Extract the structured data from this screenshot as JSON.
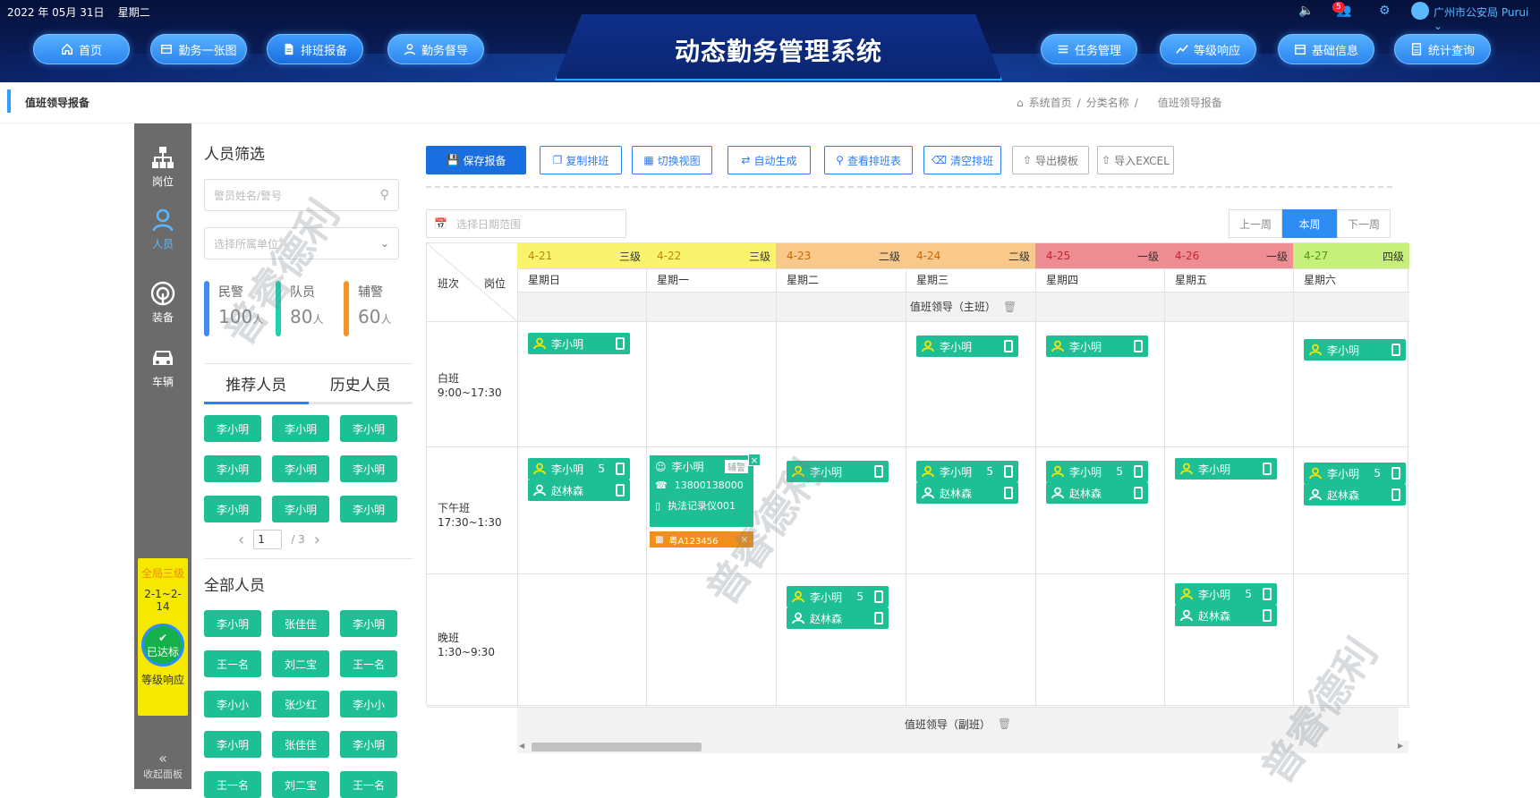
{
  "header": {
    "date": "2022 年 05月 31日",
    "weekday": "星期二",
    "title": "动态勤务管理系统",
    "left_nav": [
      {
        "label": "首页"
      },
      {
        "label": "勤务一张图"
      },
      {
        "label": "排班报备"
      },
      {
        "label": "勤务督导"
      }
    ],
    "right_nav": [
      {
        "label": "任务管理"
      },
      {
        "label": "等级响应"
      },
      {
        "label": "基础信息"
      },
      {
        "label": "统计查询"
      }
    ],
    "notify_count": "5",
    "org": "广州市公安局",
    "user": "Purui"
  },
  "breadcrumb": {
    "page": "值班领导报备",
    "items": [
      "系统首页",
      "/",
      "分类名称",
      "/",
      "值班领导报备"
    ]
  },
  "sidebar": {
    "items": [
      {
        "label": "岗位",
        "icon": "org-chart-icon"
      },
      {
        "label": "人员",
        "icon": "person-icon"
      },
      {
        "label": "装备",
        "icon": "radio-icon"
      },
      {
        "label": "车辆",
        "icon": "car-icon"
      }
    ],
    "level": "全局三级",
    "level_range": "2-1~2-14",
    "reached": "已达标",
    "response": "等级响应",
    "collapse": "收起面板"
  },
  "people": {
    "title": "人员筛选",
    "search_placeholder": "警员姓名/警号",
    "unit_placeholder": "选择所属单位",
    "stats": [
      {
        "label": "民警",
        "value": "100",
        "unit": "人",
        "color": "#3f8cf5"
      },
      {
        "label": "队员",
        "value": "80",
        "unit": "人",
        "color": "#1ed2b2"
      },
      {
        "label": "辅警",
        "value": "60",
        "unit": "人",
        "color": "#f5942a"
      }
    ],
    "tabs": [
      "推荐人员",
      "历史人员"
    ],
    "recommended": [
      "李小明",
      "李小明",
      "李小明",
      "李小明",
      "李小明",
      "李小明",
      "李小明",
      "李小明",
      "李小明"
    ],
    "page": "1",
    "page_total": "/ 3",
    "all_title": "全部人员",
    "all": [
      "李小明",
      "张佳佳",
      "李小明",
      "王一名",
      "刘二宝",
      "王一名",
      "李小小",
      "张少红",
      "李小小",
      "李小明",
      "张佳佳",
      "李小明",
      "王一名",
      "刘二宝",
      "王一名"
    ]
  },
  "toolbar": [
    "保存报备",
    "复制排班",
    "切换视图",
    "自动生成",
    "查看排班表",
    "清空排班",
    "导出模板",
    "导入EXCEL"
  ],
  "date_placeholder": "选择日期范围",
  "week_nav": [
    "上一周",
    "本周",
    "下一周"
  ],
  "schedule": {
    "corner_left": "班次",
    "corner_right": "岗位",
    "days": [
      {
        "date": "4-21",
        "level": "三级",
        "weekday": "星期日",
        "color": "#faf36e",
        "textcolor": "#c08a00"
      },
      {
        "date": "4-22",
        "level": "三级",
        "weekday": "星期一",
        "color": "#faf36e",
        "textcolor": "#c08a00"
      },
      {
        "date": "4-23",
        "level": "二级",
        "weekday": "星期二",
        "color": "#f8c98b",
        "textcolor": "#c86a00"
      },
      {
        "date": "4-24",
        "level": "二级",
        "weekday": "星期三",
        "color": "#f8c98b",
        "textcolor": "#c86a00"
      },
      {
        "date": "4-25",
        "level": "一级",
        "weekday": "星期四",
        "color": "#ee8d93",
        "textcolor": "#c0282f"
      },
      {
        "date": "4-26",
        "level": "一级",
        "weekday": "星期五",
        "color": "#ee8d93",
        "textcolor": "#c0282f"
      },
      {
        "date": "4-27",
        "level": "四级",
        "weekday": "星期六",
        "color": "#c7ef7c",
        "textcolor": "#4f9a12"
      }
    ],
    "leader_main": "值班领导（主班）",
    "leader_vice": "值班领导（副班）",
    "shifts": [
      {
        "name": "白班",
        "time": "9:00~17:30"
      },
      {
        "name": "下午班",
        "time": "17:30~1:30"
      },
      {
        "name": "晚班",
        "time": "1:30~9:30"
      }
    ],
    "card_names": {
      "a": "李小明",
      "b": "赵林森"
    },
    "count": "5",
    "popup": {
      "name": "李小明",
      "role": "辅警",
      "phone": "13800138000",
      "device": "执法记录仪001",
      "car": "粤A123456"
    }
  },
  "watermark": "普睿德利"
}
